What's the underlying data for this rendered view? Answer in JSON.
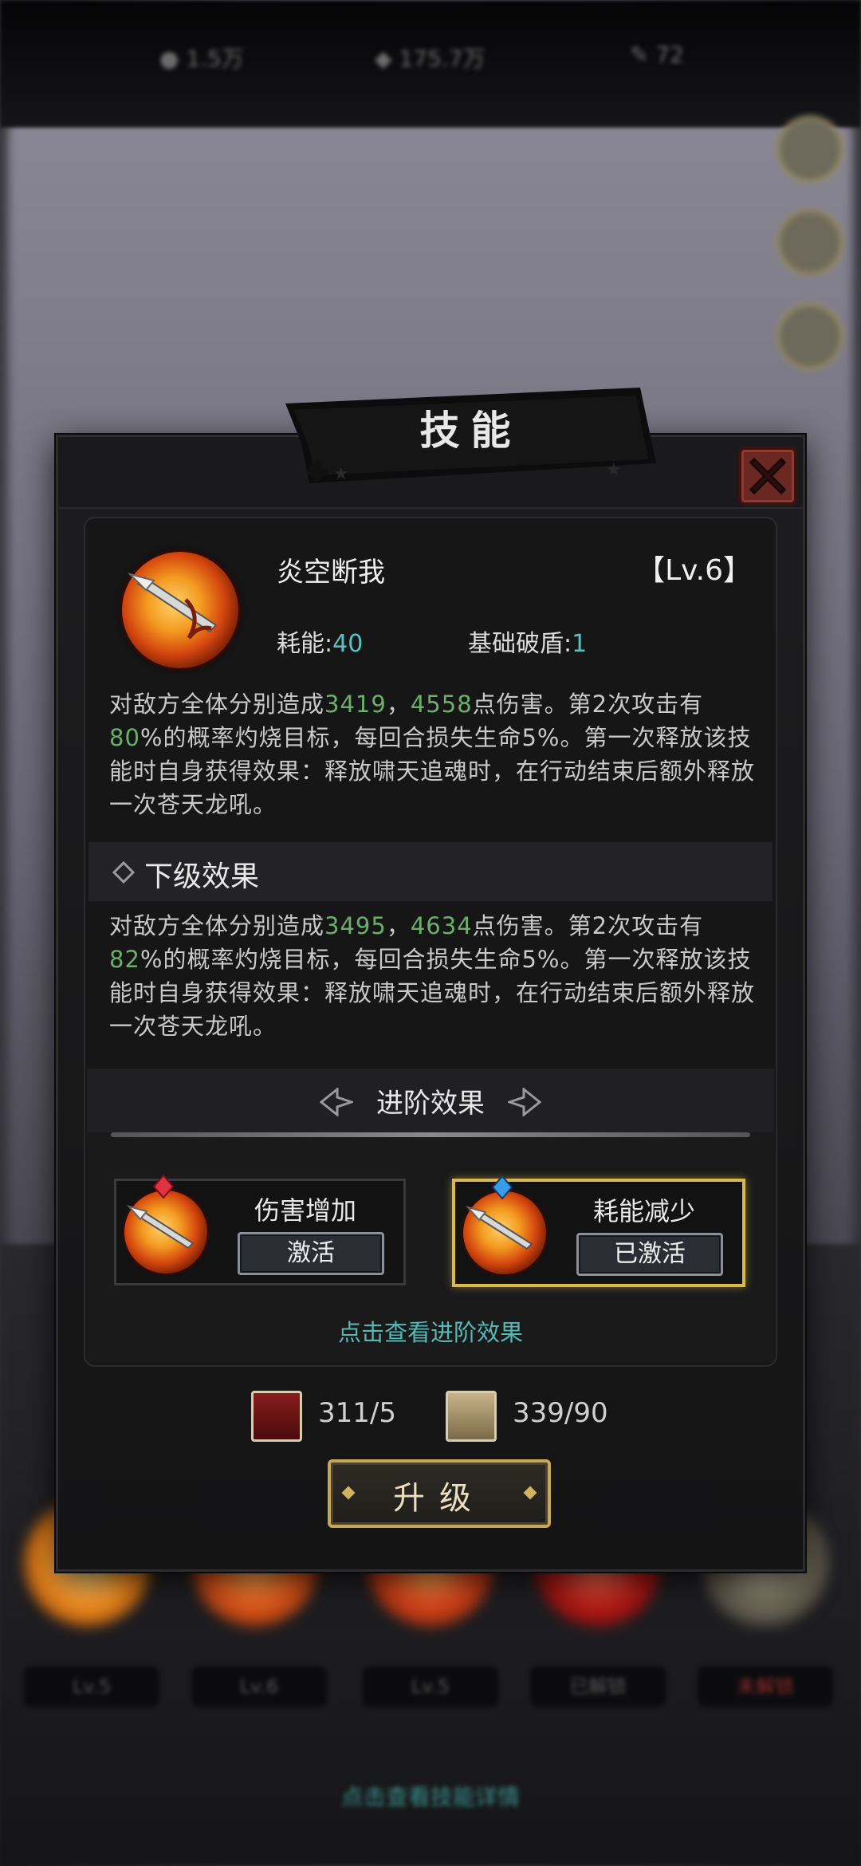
{
  "dialog": {
    "title": "技能",
    "close_icon": "close-x-icon"
  },
  "skill": {
    "name": "炎空断我",
    "level": "【Lv.6】",
    "energy_label": "耗能:",
    "energy_value": "40",
    "shield_label": "基础破盾:",
    "shield_value": "1",
    "icon": "flaming-spear-icon"
  },
  "current_effect": {
    "part1": "对敌方全体分别造成",
    "dmg1": "3419",
    "sep": "，",
    "dmg2": "4558",
    "part2": "点伤害。第2次攻击有",
    "chance": "80",
    "part3": "%的概率灼烧目标，每回合损失生命5%。第一次释放该技能时自身获得效果：释放啸天追魂时，在行动结束后额外释放一次苍天龙吼。"
  },
  "next_level": {
    "header": "下级效果",
    "part1": "对敌方全体分别造成",
    "dmg1": "3495",
    "sep": "，",
    "dmg2": "4634",
    "part2": "点伤害。第2次攻击有",
    "chance": "82",
    "part3": "%的概率灼烧目标，每回合损失生命5%。第一次释放该技能时自身获得效果：释放啸天追魂时，在行动结束后额外释放一次苍天龙吼。"
  },
  "advanced": {
    "title": "进阶效果",
    "items": [
      {
        "name": "伤害增加",
        "button": "激活",
        "gem": "red-gem-icon",
        "activated": false
      },
      {
        "name": "耗能减少",
        "button": "已激活",
        "gem": "blue-gem-icon",
        "activated": true
      }
    ],
    "link": "点击查看进阶效果"
  },
  "materials": [
    {
      "icon": "red-book-icon",
      "count": "311/5"
    },
    {
      "icon": "scroll-icon",
      "count": "339/90"
    }
  ],
  "upgrade_label": "升级",
  "background": {
    "bottom_labels": [
      "Lv.5",
      "Lv.6",
      "Lv.5",
      "已解锁",
      "未解锁"
    ],
    "bottom_link": "点击查看技能详情"
  },
  "colors": {
    "highlight_green": "#6ab06a",
    "energy_cyan": "#56c3c2",
    "active_gold": "#d9b94b",
    "link_teal": "#57b8b4",
    "close_red": "#6b2823"
  }
}
